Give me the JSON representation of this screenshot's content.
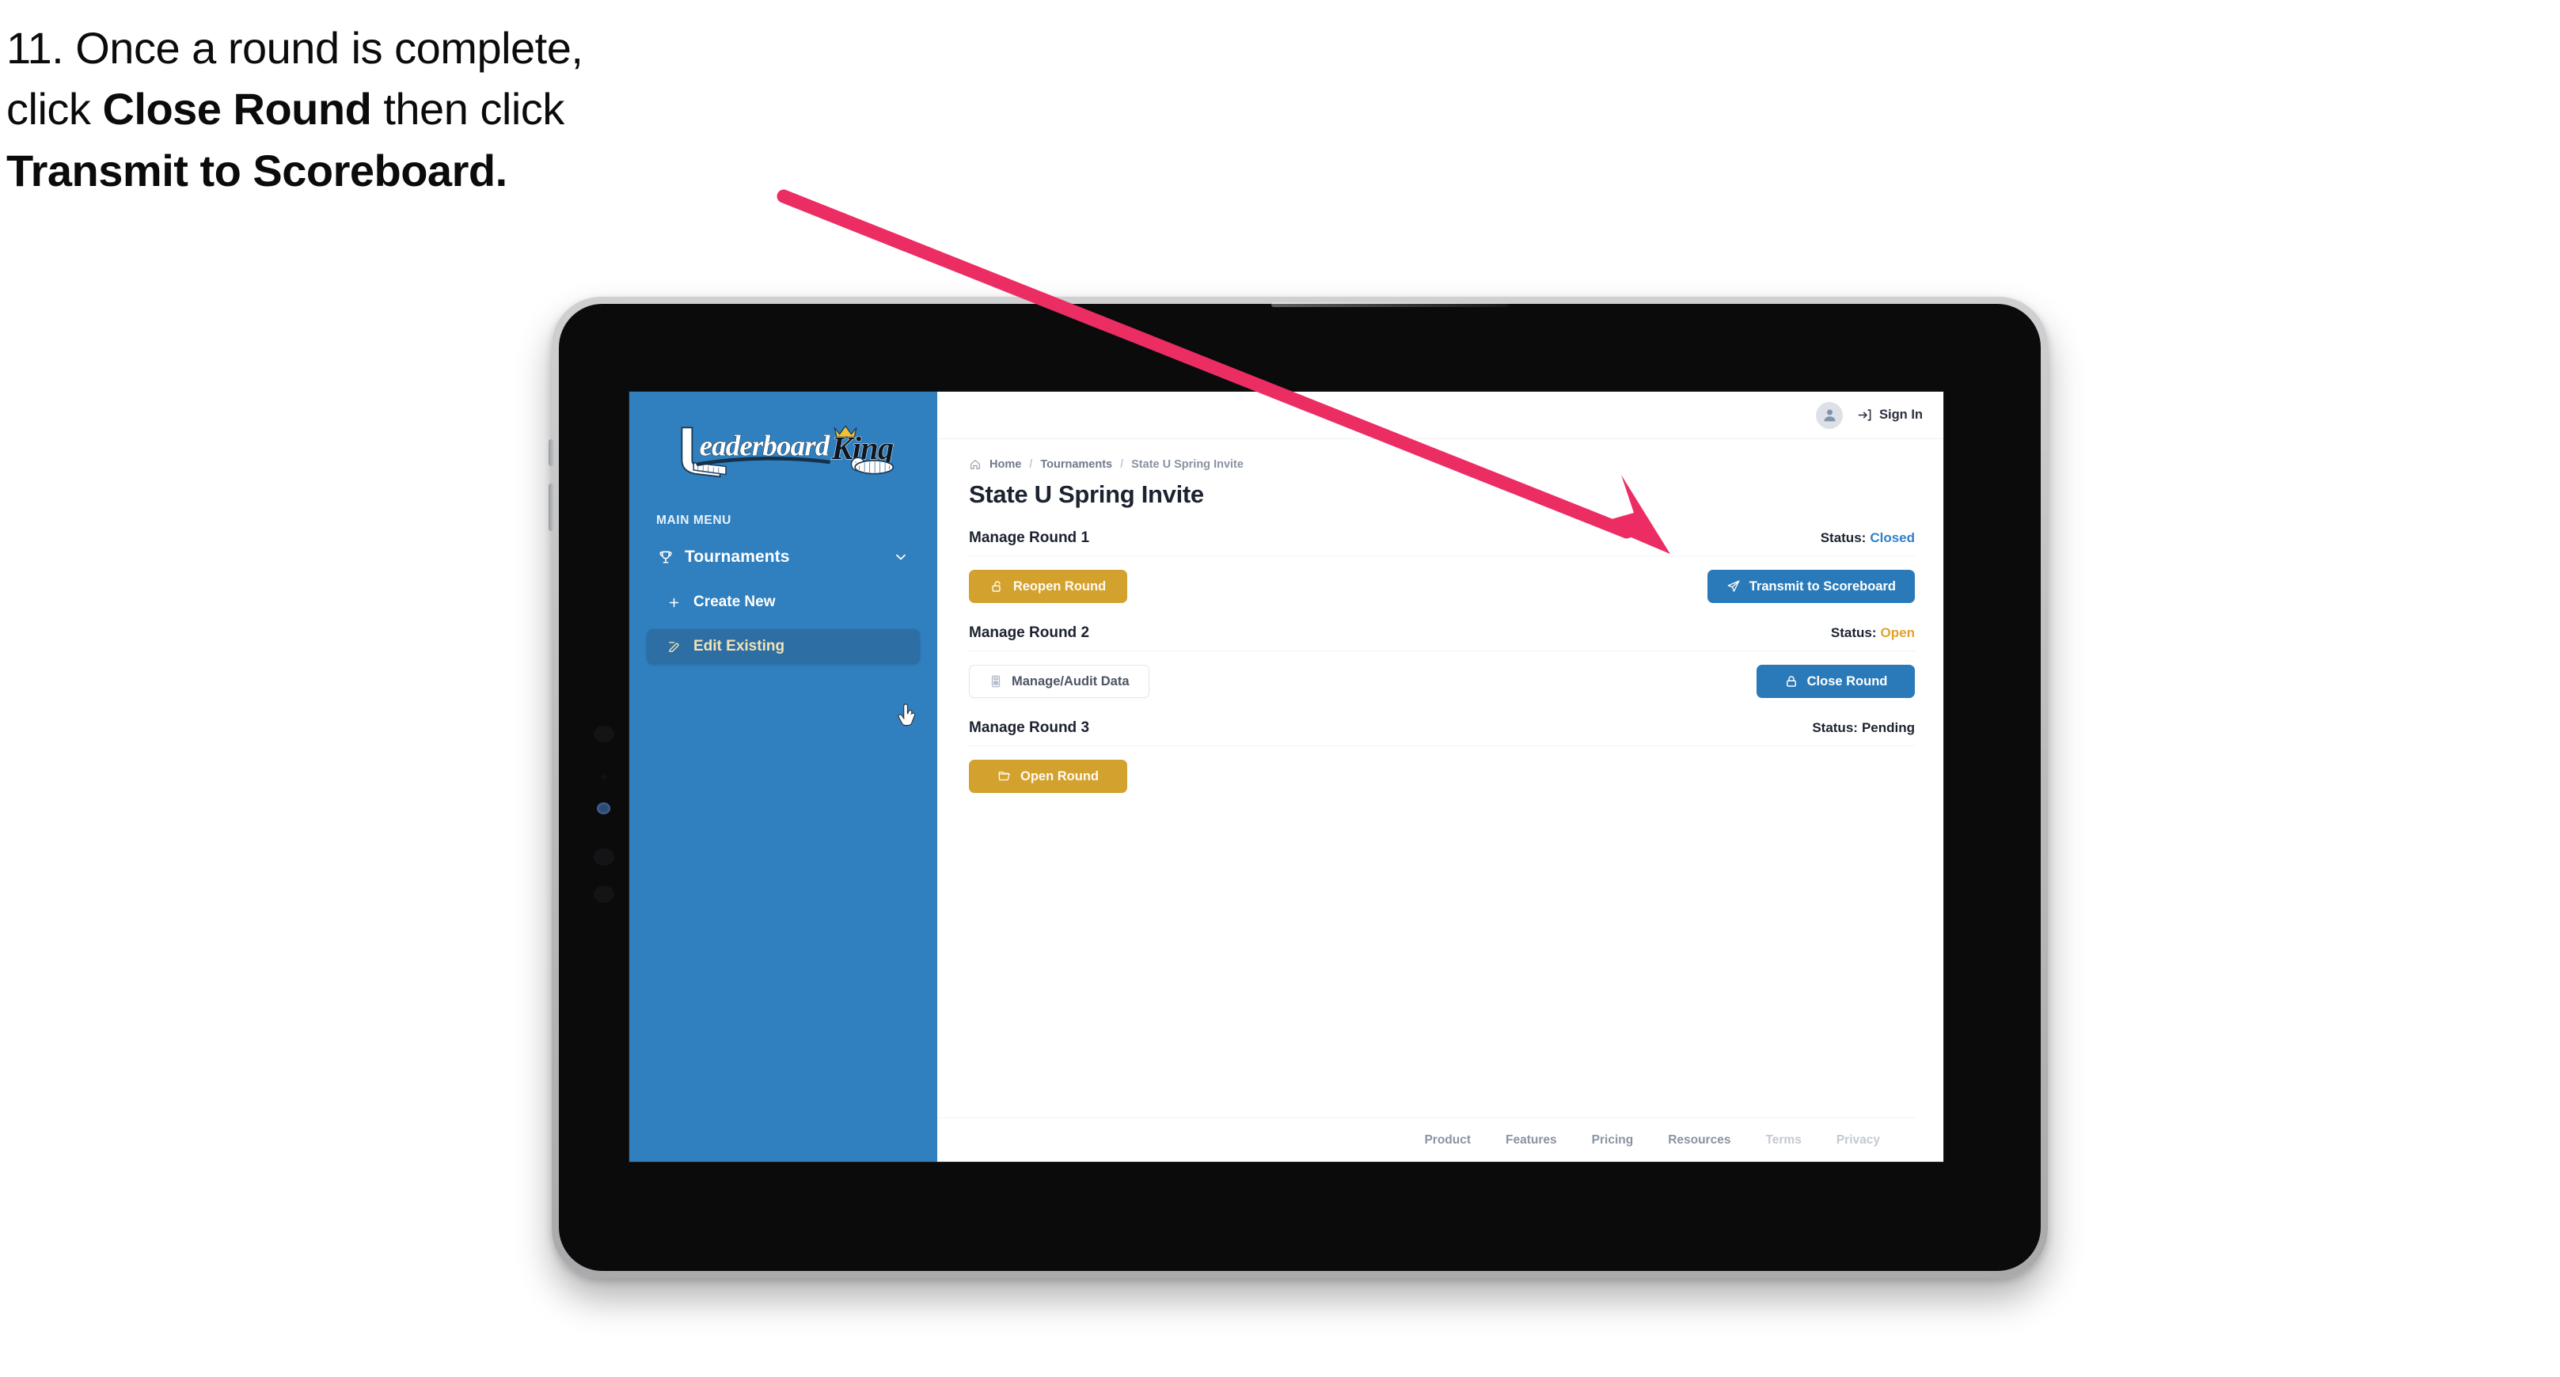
{
  "caption": {
    "line1_plain": "11. Once a round is complete,",
    "line2_pre": "click ",
    "line2_bold": "Close Round",
    "line2_post": " then click",
    "line3_bold": "Transmit to Scoreboard."
  },
  "colors": {
    "accent_blue": "#2a7ab9",
    "sidebar_blue": "#3080bf",
    "sidebar_active": "#2d6ea5",
    "gold": "#d2a12e",
    "status_closed": "#2f80c8",
    "status_open": "#e0a32e",
    "status_pending": "#1c2230",
    "arrow_pink": "#ec2d63",
    "text_dark": "#1c2230",
    "muted": "#8a93a3"
  },
  "sidebar": {
    "logo_text_left": "Leaderboard",
    "logo_text_right": "King",
    "menu_label": "MAIN MENU",
    "items": [
      {
        "label": "Tournaments",
        "icon": "trophy-icon",
        "chevron": "chevron-down-icon",
        "active": false
      },
      {
        "label": "Create New",
        "icon": "plus-icon",
        "active": false
      },
      {
        "label": "Edit Existing",
        "icon": "edit-pencil-icon",
        "active": true
      }
    ]
  },
  "topbar": {
    "avatar_icon": "user-avatar-icon",
    "signin_icon": "sign-in-arrow-icon",
    "signin_label": "Sign In"
  },
  "breadcrumb": {
    "home_icon": "home-icon",
    "items": [
      "Home",
      "Tournaments",
      "State U Spring Invite"
    ],
    "separator": "/"
  },
  "page": {
    "title": "State U Spring Invite"
  },
  "rounds": [
    {
      "title": "Manage Round 1",
      "status_label": "Status:",
      "status_value": "Closed",
      "status_color": "#2f80c8",
      "left_button": {
        "label": "Reopen Round",
        "icon": "unlock-icon",
        "style": "gold"
      },
      "right_button": {
        "label": "Transmit to Scoreboard",
        "icon": "send-plane-icon",
        "style": "blue"
      }
    },
    {
      "title": "Manage Round 2",
      "status_label": "Status:",
      "status_value": "Open",
      "status_color": "#e0a32e",
      "left_button": {
        "label": "Manage/Audit Data",
        "icon": "calculator-icon",
        "style": "ghost"
      },
      "right_button": {
        "label": "Close Round",
        "icon": "lock-icon",
        "style": "blue"
      }
    },
    {
      "title": "Manage Round 3",
      "status_label": "Status:",
      "status_value": "Pending",
      "status_color": "#1c2230",
      "left_button": {
        "label": "Open Round",
        "icon": "folder-open-icon",
        "style": "gold"
      },
      "right_button": null
    }
  ],
  "footer": {
    "links": [
      {
        "label": "Product",
        "dim": false
      },
      {
        "label": "Features",
        "dim": false
      },
      {
        "label": "Pricing",
        "dim": false
      },
      {
        "label": "Resources",
        "dim": false
      },
      {
        "label": "Terms",
        "dim": true
      },
      {
        "label": "Privacy",
        "dim": true
      }
    ]
  },
  "annotation": {
    "arrow_name": "pointer-arrow-to-transmit-button"
  }
}
